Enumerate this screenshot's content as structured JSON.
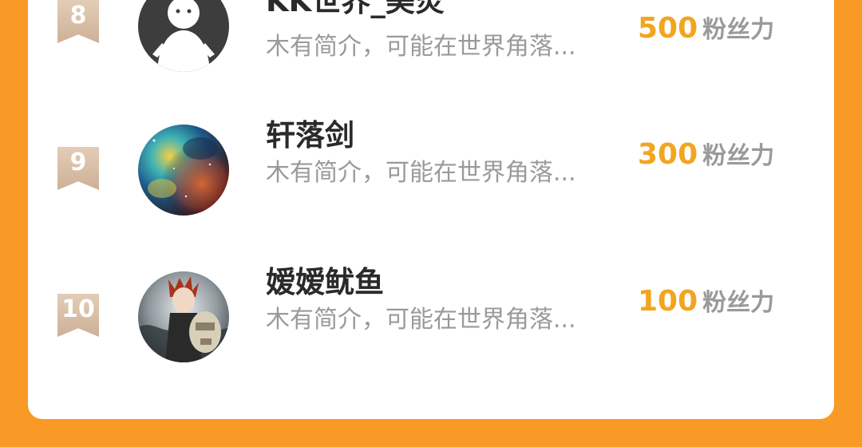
{
  "colors": {
    "page_background": "#f99a26",
    "card_background": "#ffffff",
    "score_accent": "#f2a51f",
    "muted_text": "#9a9a9a",
    "name_text": "#2a2a2a",
    "rank_badge": "#d6bca3"
  },
  "ranking": {
    "items": [
      {
        "rank": "8",
        "name": "KK世界_美炎",
        "bio": "木有简介，可能在世界角落...",
        "score": "500",
        "score_unit": "粉丝力",
        "avatar_icon": "default-user-icon"
      },
      {
        "rank": "9",
        "name": "轩落剑",
        "bio": "木有简介，可能在世界角落...",
        "score": "300",
        "score_unit": "粉丝力",
        "avatar_icon": "nebula-avatar"
      },
      {
        "rank": "10",
        "name": "嫒嫒鱿鱼",
        "bio": "木有简介，可能在世界角落...",
        "score": "100",
        "score_unit": "粉丝力",
        "avatar_icon": "anime-character-avatar"
      }
    ]
  }
}
